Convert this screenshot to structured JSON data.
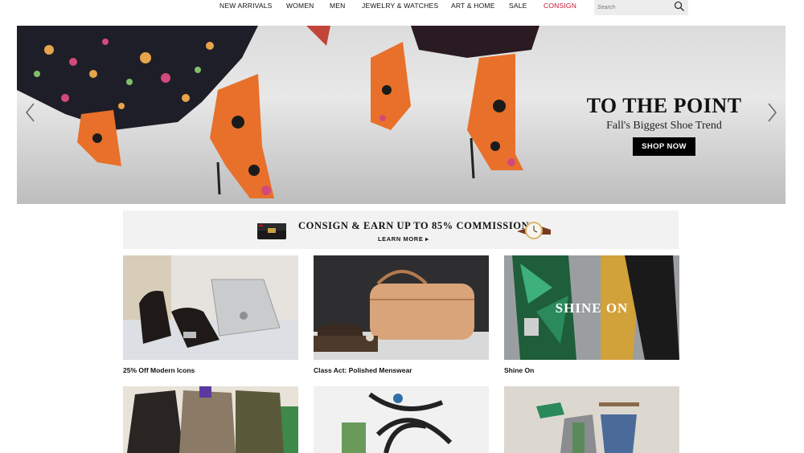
{
  "nav": {
    "items": [
      "NEW ARRIVALS",
      "WOMEN",
      "MEN",
      "JEWELRY & WATCHES",
      "ART & HOME",
      "SALE",
      "CONSIGN"
    ],
    "search_placeholder": "Search"
  },
  "hero": {
    "title": "TO THE POINT",
    "subtitle": "Fall's Biggest Shoe Trend",
    "cta": "SHOP NOW"
  },
  "consign_banner": {
    "headline": "CONSIGN & EARN UP TO 85% COMMISSION",
    "cta": "LEARN MORE ▸"
  },
  "tiles": [
    {
      "caption": "25% Off Modern Icons"
    },
    {
      "caption": "Class Act: Polished Menswear"
    },
    {
      "caption": "Shine On",
      "overlay": "SHINE ON"
    },
    {
      "caption": ""
    },
    {
      "caption": ""
    },
    {
      "caption": ""
    }
  ],
  "colors": {
    "accent_red": "#c8102e",
    "button_black": "#000000"
  }
}
